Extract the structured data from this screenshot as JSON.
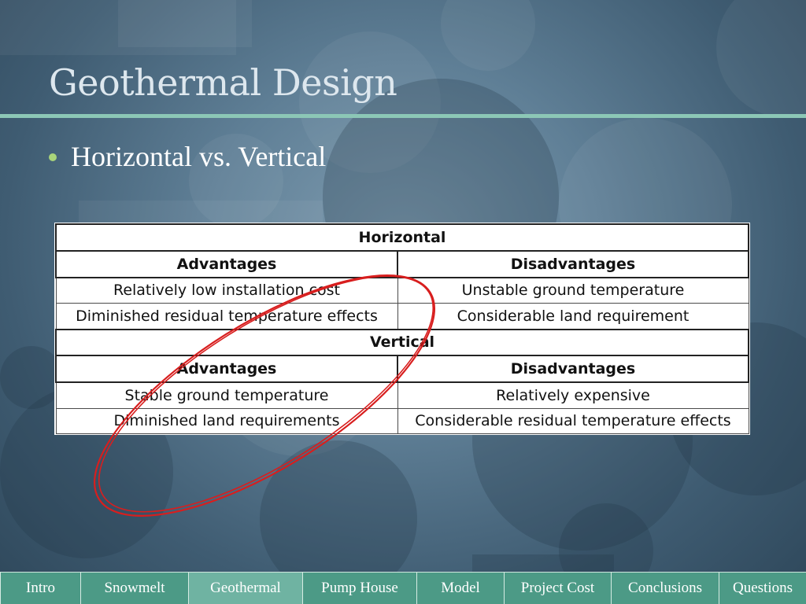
{
  "slide": {
    "title": "Geothermal Design",
    "bullet": "Horizontal vs. Vertical"
  },
  "table": {
    "sections": [
      {
        "heading": "Horizontal",
        "advantages_label": "Advantages",
        "disadvantages_label": "Disadvantages",
        "rows": [
          {
            "advantage": "Relatively low installation cost",
            "disadvantage": "Unstable ground temperature"
          },
          {
            "advantage": "Diminished residual temperature effects",
            "disadvantage": "Considerable land requirement"
          }
        ]
      },
      {
        "heading": "Vertical",
        "advantages_label": "Advantages",
        "disadvantages_label": "Disadvantages",
        "rows": [
          {
            "advantage": "Stable ground temperature",
            "disadvantage": "Relatively expensive"
          },
          {
            "advantage": "Diminished land requirements",
            "disadvantage": "Considerable residual temperature effects"
          }
        ]
      }
    ]
  },
  "nav": {
    "items": [
      {
        "label": "Intro"
      },
      {
        "label": "Snowmelt"
      },
      {
        "label": "Geothermal"
      },
      {
        "label": "Pump House"
      },
      {
        "label": "Model"
      },
      {
        "label": "Project Cost"
      },
      {
        "label": "Conclusions"
      },
      {
        "label": "Questions"
      }
    ],
    "active": "Geothermal"
  },
  "colors": {
    "accent_rule": "#8cc7b6",
    "bullet_dot": "#a9d47a",
    "nav_background": "#4c9a86",
    "nav_active": "#6fb3a2",
    "annotation_ellipse": "#d81e1e"
  }
}
